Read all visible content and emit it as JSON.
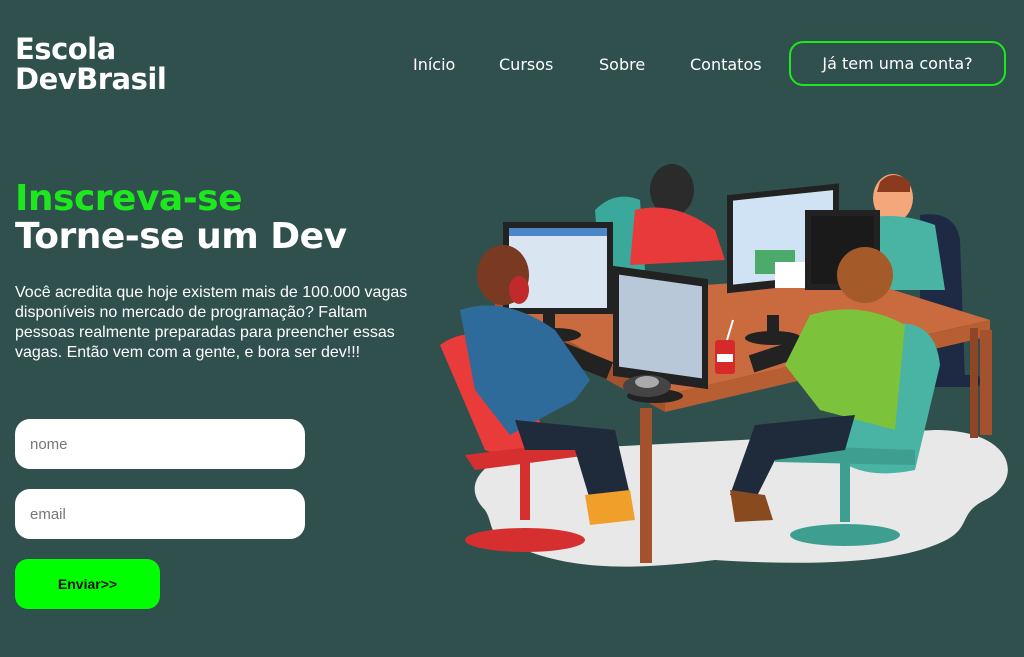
{
  "logo": {
    "line1": "Escola",
    "line2": "DevBrasil"
  },
  "nav": {
    "items": [
      {
        "label": "Início"
      },
      {
        "label": "Cursos"
      },
      {
        "label": "Sobre"
      },
      {
        "label": "Contatos"
      }
    ],
    "login_label": "Já tem uma conta?"
  },
  "hero": {
    "title_accent": "Inscreva-se",
    "title_main": "Torne-se um Dev",
    "text": "Você acredita que hoje existem mais de 100.000 vagas disponíveis no mercado de programação? Faltam pessoas realmente preparadas para preencher essas vagas. Então vem com a gente, e bora ser dev!!!"
  },
  "form": {
    "name_placeholder": "nome",
    "email_placeholder": "email",
    "submit_label": "Enviar>>"
  },
  "colors": {
    "background": "#30504e",
    "accent": "#1de81d",
    "button": "#00ff00"
  },
  "illustration": {
    "icon": "team-coding-illustration"
  }
}
